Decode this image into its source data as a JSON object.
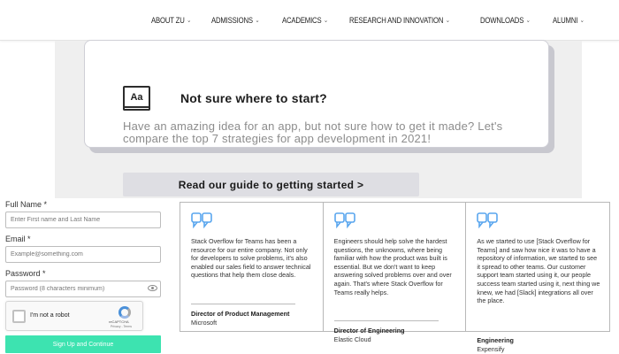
{
  "nav": {
    "items": [
      {
        "label": "ABOUT ZU"
      },
      {
        "label": "ADMISSIONS"
      },
      {
        "label": "ACADEMICS"
      },
      {
        "label": "RESEARCH AND INNOVATION"
      },
      {
        "label": "DOWNLOADS"
      },
      {
        "label": "ALUMNI"
      }
    ],
    "chevron_icon": "chevron-down-icon"
  },
  "hero": {
    "icon_text": "Aa",
    "title": "Not sure where to start?",
    "body": "Have an amazing idea for an app, but not sure how to get it made? Let's compare the top 7 strategies for app development in 2021!",
    "button_label": "Read our guide to getting started >"
  },
  "form": {
    "full_name": {
      "label": "Full Name *",
      "placeholder": "Enter First name and Last Name",
      "value": ""
    },
    "email": {
      "label": "Email *",
      "placeholder": "Example@something.com",
      "value": ""
    },
    "password": {
      "label": "Password *",
      "placeholder": "Password (8 characters minimum)",
      "value": ""
    },
    "captcha": {
      "label": "I'm not a robot",
      "brand": "reCAPTCHA",
      "links": "Privacy - Terms"
    },
    "submit_label": "Sign Up and Continue",
    "accent_color": "#3de3b0"
  },
  "testimonials": [
    {
      "text": "Stack Overflow for Teams has been a resource for our entire company. Not only for developers to solve problems, it's also enabled our sales field to answer technical questions that help them close deals.",
      "role": "Director of Product Management",
      "company": "Microsoft"
    },
    {
      "text": "Engineers should help solve the hardest questions, the unknowns, where being familiar with how the product was built is essential. But we don't want to keep answering solved problems over and over again. That's where Stack Overflow for Teams really helps.",
      "role": "Director of Engineering",
      "company": "Elastic Cloud"
    },
    {
      "text": "As we started to use [Stack Overflow for Teams] and saw how nice it was to have a repository of information, we started to see it spread to other teams. Our customer support team started using it, our people success team started using it, next thing we knew, we had [Slack] integrations all over the place.",
      "role": "Engineering",
      "company": "Expensify"
    }
  ],
  "quote_icon_color": "#5aa6ee"
}
